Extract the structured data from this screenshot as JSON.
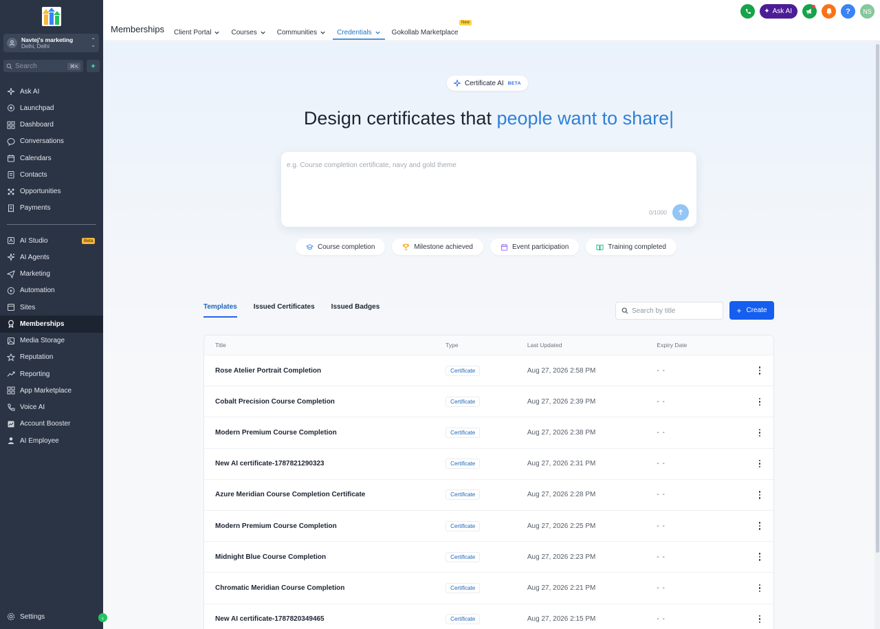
{
  "sidebar": {
    "account": {
      "name": "Navtej's marketing",
      "location": "Delhi, Delhi"
    },
    "search": {
      "placeholder": "Search",
      "shortcut": "⌘K"
    },
    "items_top": [
      {
        "label": "Ask AI",
        "icon": "sparkle-icon"
      },
      {
        "label": "Launchpad",
        "icon": "rocket-icon"
      },
      {
        "label": "Dashboard",
        "icon": "grid-icon"
      },
      {
        "label": "Conversations",
        "icon": "chat-icon"
      },
      {
        "label": "Calendars",
        "icon": "calendar-icon"
      },
      {
        "label": "Contacts",
        "icon": "contacts-icon"
      },
      {
        "label": "Opportunities",
        "icon": "opportunities-icon"
      },
      {
        "label": "Payments",
        "icon": "receipt-icon"
      }
    ],
    "items_bottom": [
      {
        "label": "AI Studio",
        "icon": "ai-studio-icon",
        "badge": "Beta"
      },
      {
        "label": "AI Agents",
        "icon": "agents-icon"
      },
      {
        "label": "Marketing",
        "icon": "send-icon"
      },
      {
        "label": "Automation",
        "icon": "automation-icon"
      },
      {
        "label": "Sites",
        "icon": "sites-icon"
      },
      {
        "label": "Memberships",
        "icon": "award-icon",
        "active": true
      },
      {
        "label": "Media Storage",
        "icon": "image-icon"
      },
      {
        "label": "Reputation",
        "icon": "star-icon"
      },
      {
        "label": "Reporting",
        "icon": "trend-icon"
      },
      {
        "label": "App Marketplace",
        "icon": "apps-icon"
      },
      {
        "label": "Voice AI",
        "icon": "phone-icon"
      },
      {
        "label": "Account Booster",
        "icon": "booster-icon"
      },
      {
        "label": "AI Employee",
        "icon": "person-icon"
      }
    ],
    "settings_label": "Settings"
  },
  "topbar": {
    "title": "Memberships",
    "tabs": [
      {
        "label": "Client Portal",
        "dropdown": true
      },
      {
        "label": "Courses",
        "dropdown": true
      },
      {
        "label": "Communities",
        "dropdown": true
      },
      {
        "label": "Credentials",
        "dropdown": true,
        "active": true
      },
      {
        "label": "Gokollab Marketplace",
        "dropdown": false
      }
    ],
    "new_badge": "New",
    "ask_ai": "Ask AI",
    "user_initials": "NS"
  },
  "hero": {
    "badge": "Certificate AI",
    "badge_tag": "BETA",
    "headline_start": "Design certificates that ",
    "headline_accent": "people want to share",
    "prompt_placeholder": "e.g. Course completion certificate, navy and gold theme",
    "char_count": "0/1000",
    "chips": [
      {
        "label": "Course completion",
        "icon": "cap-icon",
        "color": "#3b82f6"
      },
      {
        "label": "Milestone achieved",
        "icon": "trophy-icon",
        "color": "#f59e0b"
      },
      {
        "label": "Event participation",
        "icon": "calendar-icon",
        "color": "#8b5cf6"
      },
      {
        "label": "Training completed",
        "icon": "book-icon",
        "color": "#10b981"
      }
    ]
  },
  "content_tabs": [
    "Templates",
    "Issued Certificates",
    "Issued Badges"
  ],
  "table_search_placeholder": "Search by title",
  "create_label": "Create",
  "table": {
    "columns": [
      "Title",
      "Type",
      "Last Updated",
      "Expiry Date"
    ],
    "rows": [
      {
        "title": "Rose Atelier Portrait Completion",
        "type": "Certificate",
        "updated": "Aug 27, 2026 2:58 PM",
        "expiry": "- -"
      },
      {
        "title": "Cobalt Precision Course Completion",
        "type": "Certificate",
        "updated": "Aug 27, 2026 2:39 PM",
        "expiry": "- -"
      },
      {
        "title": "Modern Premium Course Completion",
        "type": "Certificate",
        "updated": "Aug 27, 2026 2:38 PM",
        "expiry": "- -"
      },
      {
        "title": "New AI certificate-1787821290323",
        "type": "Certificate",
        "updated": "Aug 27, 2026 2:31 PM",
        "expiry": "- -"
      },
      {
        "title": "Azure Meridian Course Completion Certificate",
        "type": "Certificate",
        "updated": "Aug 27, 2026 2:28 PM",
        "expiry": "- -"
      },
      {
        "title": "Modern Premium Course Completion",
        "type": "Certificate",
        "updated": "Aug 27, 2026 2:25 PM",
        "expiry": "- -"
      },
      {
        "title": "Midnight Blue Course Completion",
        "type": "Certificate",
        "updated": "Aug 27, 2026 2:23 PM",
        "expiry": "- -"
      },
      {
        "title": "Chromatic Meridian Course Completion",
        "type": "Certificate",
        "updated": "Aug 27, 2026 2:21 PM",
        "expiry": "- -"
      },
      {
        "title": "New AI certificate-1787820349465",
        "type": "Certificate",
        "updated": "Aug 27, 2026 2:15 PM",
        "expiry": "- -"
      }
    ]
  },
  "colors": {
    "sidebar_bg": "#2b3445",
    "accent": "#155eef",
    "headline_accent": "#2f80d8"
  }
}
